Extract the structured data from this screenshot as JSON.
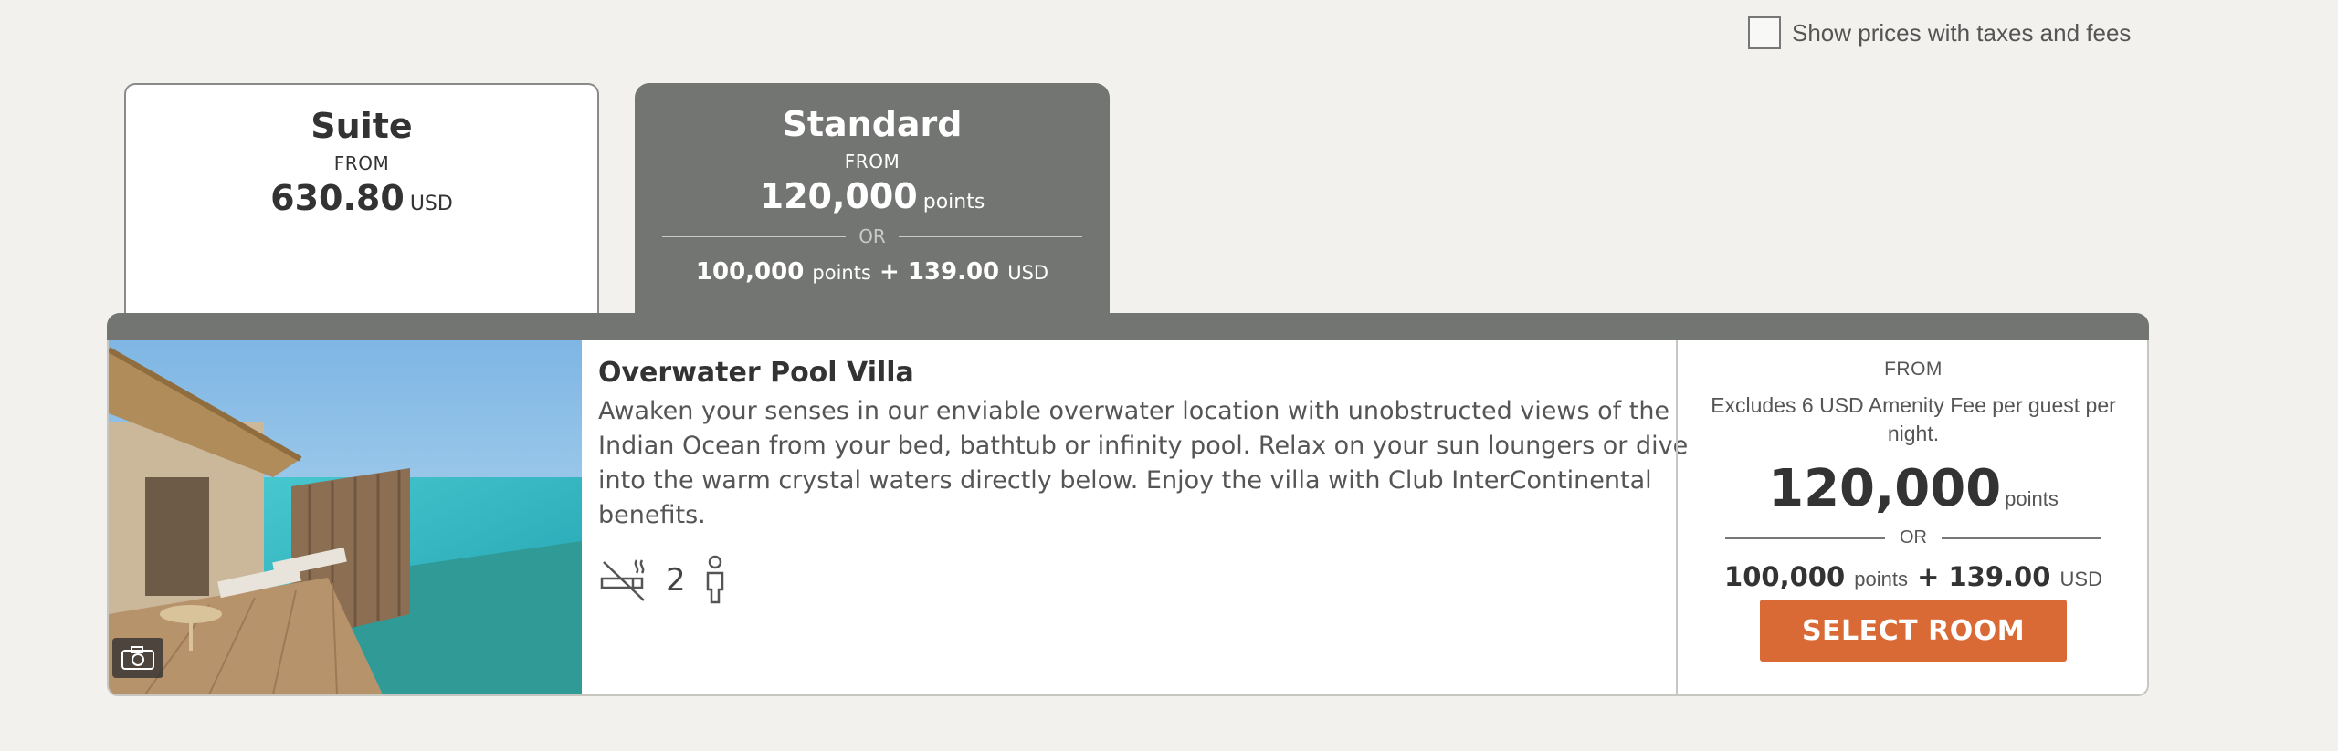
{
  "tax_toggle": {
    "label": "Show prices with taxes and fees",
    "checked": false
  },
  "tabs": [
    {
      "title": "Suite",
      "from": "FROM",
      "price": "630.80",
      "currency": "USD",
      "selected": false
    },
    {
      "title": "Standard",
      "from": "FROM",
      "points": "120,000",
      "points_unit": "points",
      "or": "OR",
      "combo_points": "100,000",
      "combo_points_unit": "points",
      "plus": "+",
      "combo_cash": "139.00",
      "combo_currency": "USD",
      "selected": true
    }
  ],
  "room": {
    "name": "Overwater Pool Villa",
    "description": "Awaken your senses in our enviable overwater location with unobstructed views of the Indian Ocean from your bed, bathtub or infinity pool. Relax on your sun loungers or dive into the warm crystal waters directly below. Enjoy the villa with Club InterContinental benefits.",
    "occupancy": "2",
    "icons": [
      "no-smoking-icon",
      "person-icon",
      "camera-icon"
    ]
  },
  "price_panel": {
    "from": "FROM",
    "fee_note": "Excludes 6 USD Amenity Fee per guest per night.",
    "points": "120,000",
    "points_unit": "points",
    "or": "OR",
    "combo_points": "100,000",
    "combo_points_unit": "points",
    "plus": "+",
    "combo_cash": "139.00",
    "combo_currency": "USD",
    "button_label": "SELECT ROOM"
  },
  "colors": {
    "accent": "#d96a35",
    "tab_active": "#737572",
    "background": "#f2f1ee"
  }
}
